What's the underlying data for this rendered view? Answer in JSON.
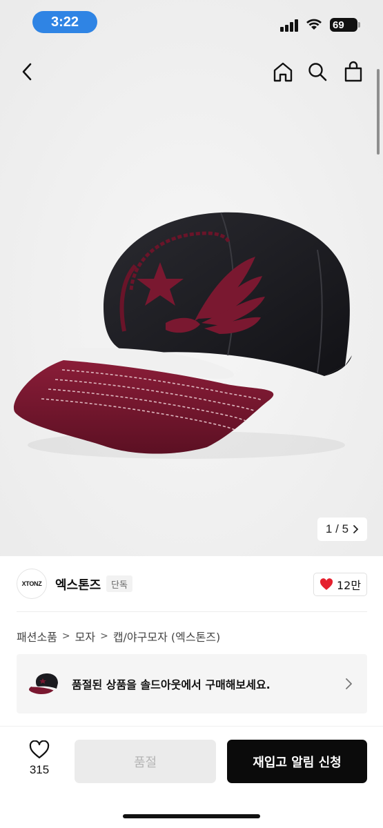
{
  "status_bar": {
    "time": "3:22",
    "battery": "69"
  },
  "nav": {
    "back_icon": "chevron-left-icon",
    "home_icon": "home-icon",
    "search_icon": "search-icon",
    "bag_icon": "shopping-bag-icon"
  },
  "gallery": {
    "current": "1",
    "separator": "/",
    "total": "5",
    "product_image": "black baseball cap with burgundy brim and winged star embroidery"
  },
  "brand": {
    "logo_text": "XTONZ",
    "name": "엑스톤즈",
    "tag": "단독",
    "likes": "12만"
  },
  "breadcrumb": [
    "패션소품",
    "모자",
    "캡/야구모자 (엑스톤즈)"
  ],
  "soldout_banner": {
    "text": "품절된 상품을 솔드아웃에서 구매해보세요."
  },
  "bottom_bar": {
    "wish_count": "315",
    "soldout_label": "품절",
    "restock_label": "재입고 알림 신청"
  },
  "colors": {
    "time_pill": "#2f84e4",
    "like_heart": "#e5202e",
    "cap_body": "#1b1b1f",
    "cap_accent": "#7a1830",
    "primary_button": "#0b0b0b"
  }
}
